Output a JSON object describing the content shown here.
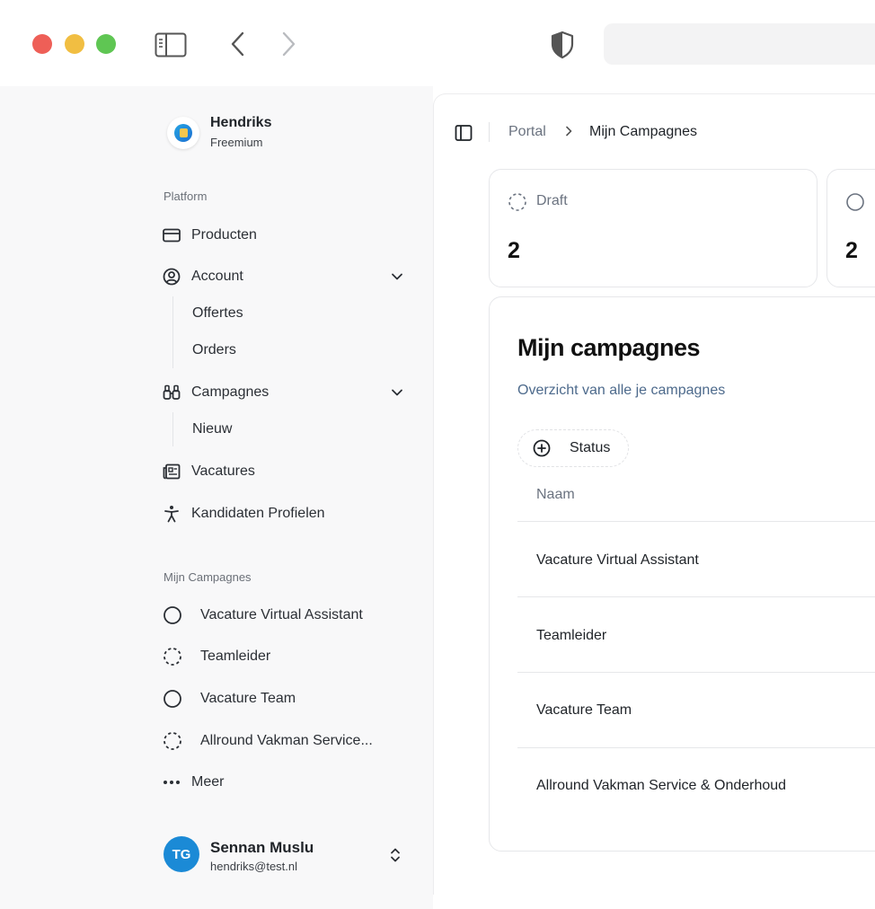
{
  "colors": {
    "accent": "#1b8ad6",
    "muted_link": "#4d6a8c"
  },
  "workspace": {
    "name": "Hendriks",
    "plan": "Freemium"
  },
  "sidebar": {
    "platform_label": "Platform",
    "items": [
      {
        "label": "Producten",
        "icon": "card-icon"
      },
      {
        "label": "Account",
        "icon": "user-circle-icon",
        "children": [
          "Offertes",
          "Orders"
        ]
      },
      {
        "label": "Campagnes",
        "icon": "binoculars-icon",
        "children": [
          "Nieuw"
        ]
      },
      {
        "label": "Vacatures",
        "icon": "newspaper-icon"
      },
      {
        "label": "Kandidaten Profielen",
        "icon": "person-icon"
      }
    ],
    "campaigns_label": "Mijn Campagnes",
    "campaigns": [
      {
        "label": "Vacature Virtual Assistant",
        "status_icon": "circle-icon"
      },
      {
        "label": "Teamleider",
        "status_icon": "dashed-circle-icon"
      },
      {
        "label": "Vacature Team",
        "status_icon": "circle-icon"
      },
      {
        "label": "Allround Vakman Service...",
        "status_icon": "dashed-circle-icon"
      }
    ],
    "more_label": "Meer"
  },
  "user": {
    "initials": "TG",
    "name": "Sennan Muslu",
    "email": "hendriks@test.nl"
  },
  "breadcrumb": {
    "parent": "Portal",
    "current": "Mijn Campagnes"
  },
  "stats": [
    {
      "label": "Draft",
      "value": "2"
    },
    {
      "label": "",
      "value": "2"
    }
  ],
  "list": {
    "title": "Mijn campagnes",
    "subtitle": "Overzicht van alle je campagnes",
    "filter_label": "Status",
    "column": "Naam",
    "rows": [
      "Vacature Virtual Assistant",
      "Teamleider",
      "Vacature Team",
      "Allround Vakman Service & Onderhoud"
    ]
  }
}
